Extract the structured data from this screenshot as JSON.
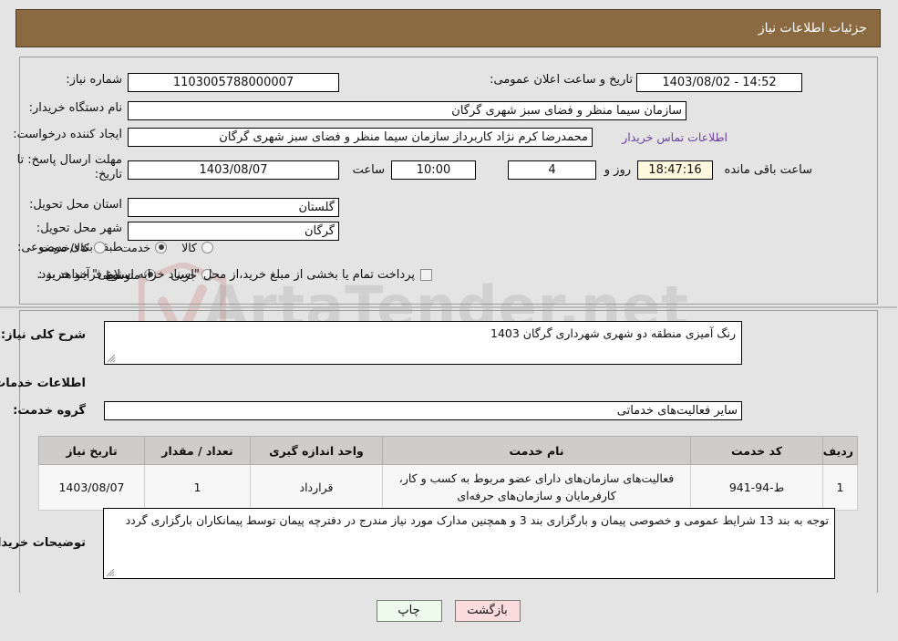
{
  "header": {
    "title": "جزئیات اطلاعات نیاز"
  },
  "top_section": {
    "need_number_label": "شماره نیاز:",
    "need_number_value": "1103005788000007",
    "announce_datetime_label": "تاریخ و ساعت اعلان عمومی:",
    "announce_datetime_value": "1403/08/02 - 14:52",
    "buyer_org_label": "نام دستگاه خریدار:",
    "buyer_org_value": "سازمان سیما  منظر و فضای سبز شهری گرگان",
    "requester_label": "ایجاد کننده درخواست:",
    "requester_value": "محمدرضا کرم نژاد کاربرداز سازمان سیما  منظر و فضای سبز شهری گرگان",
    "contact_link": "اطلاعات تماس خریدار",
    "deadline_label": "مهلت ارسال پاسخ: تا تاریخ:",
    "deadline_date": "1403/08/07",
    "time_label": "ساعت",
    "time_value": "10:00",
    "days_value": "4",
    "days_suffix": "روز و",
    "countdown_value": "18:47:16",
    "countdown_suffix": "ساعت باقی مانده",
    "province_label": "استان محل تحویل:",
    "province_value": "گلستان",
    "city_label": "شهر محل تحویل:",
    "city_value": "گرگان",
    "category_label": "طبقه بندی موضوعی:",
    "category_options": [
      {
        "label": "کالا",
        "selected": false
      },
      {
        "label": "خدمت",
        "selected": true
      },
      {
        "label": "کالا/خدمت",
        "selected": false
      }
    ],
    "process_label": "نوع فرآیند خرید :",
    "process_options": [
      {
        "label": "جزیی",
        "selected": false
      },
      {
        "label": "متوسط",
        "selected": true
      }
    ],
    "treasury_note": "پرداخت تمام یا بخشی از مبلغ خرید،از محل \"اسناد خزانه اسلامی\" خواهد بود.",
    "treasury_checked": false
  },
  "bottom_section": {
    "description_label": "شرح کلی نیاز:",
    "description_value": "رنگ آمیزی منطقه دو شهری شهرداری گرگان 1403",
    "services_section_title": "اطلاعات خدمات مورد نیاز",
    "service_group_label": "گروه خدمت:",
    "service_group_value": "سایر فعالیت‌های خدماتی",
    "buyer_notes_label": "توضیحات خریدار:",
    "buyer_notes_value": "توجه به بند 13 شرایط عمومی و خصوصی پیمان و  بارگزاری بند 3 و همچنین مدارک مورد نیاز مندرج در دفترچه پیمان توسط پیمانکاران بارگزاری گردد"
  },
  "table": {
    "headers": [
      "ردیف",
      "کد خدمت",
      "نام خدمت",
      "واحد اندازه گیری",
      "تعداد / مقدار",
      "تاریخ نیاز"
    ],
    "rows": [
      {
        "index": "1",
        "code": "ط-94-941",
        "name": "فعالیت‌های سازمان‌های دارای عضو مربوط به کسب و کار، کارفرمایان و سازمان‌های حرفه‌ای",
        "unit": "قرارداد",
        "quantity": "1",
        "need_date": "1403/08/07"
      }
    ]
  },
  "footer": {
    "print_label": "چاپ",
    "back_label": "بازگشت"
  },
  "watermark": {
    "text": "ArtaTender.net"
  },
  "colors": {
    "header_bg": "#8b6a41",
    "page_bg": "#e4e4e4",
    "link": "#6a3fa0",
    "table_header_bg": "#cfcdcb",
    "print_btn_bg": "#ecfbec",
    "back_btn_bg": "#fbdcdc",
    "countdown_bg": "#fbf8dd"
  }
}
